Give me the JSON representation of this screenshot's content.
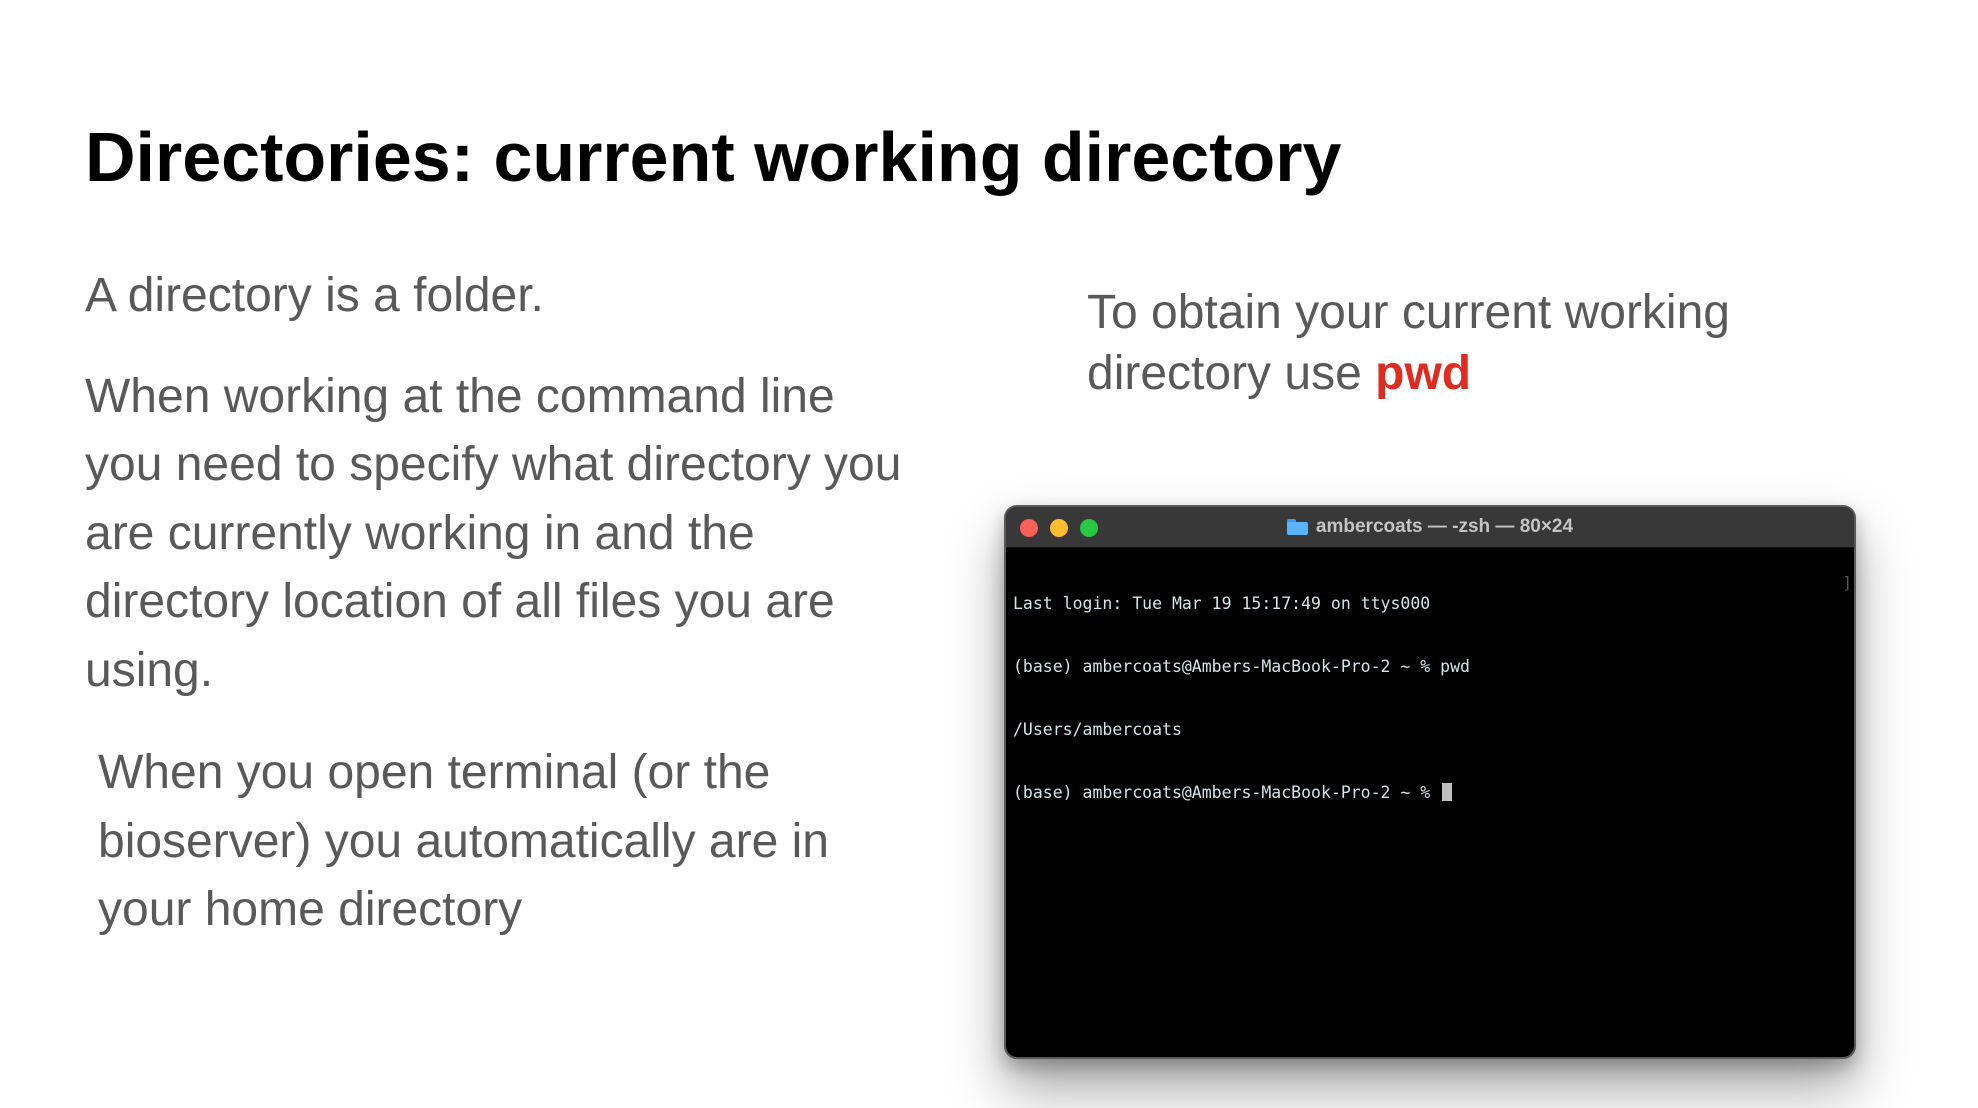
{
  "slide": {
    "title": "Directories: current working directory",
    "left_paragraphs": [
      "A directory is a folder.",
      "When working at the command line you need to specify what directory you are currently working in and the directory location of all files you are using.",
      "When you open terminal (or the bioserver) you automatically are in your home directory"
    ],
    "right_text": {
      "prefix": "To obtain your current working directory use ",
      "command": "pwd"
    },
    "colors": {
      "body_text": "#595959",
      "command_highlight": "#e02b20"
    }
  },
  "terminal": {
    "window_title": "ambercoats — -zsh — 80×24",
    "lines": [
      "Last login: Tue Mar 19 15:17:49 on ttys000",
      "(base) ambercoats@Ambers-MacBook-Pro-2 ~ % pwd",
      "/Users/ambercoats",
      "(base) ambercoats@Ambers-MacBook-Pro-2 ~ % "
    ],
    "traffic_light_colors": {
      "close": "#fe5f57",
      "minimize": "#febc2e",
      "maximize": "#28c840"
    }
  }
}
